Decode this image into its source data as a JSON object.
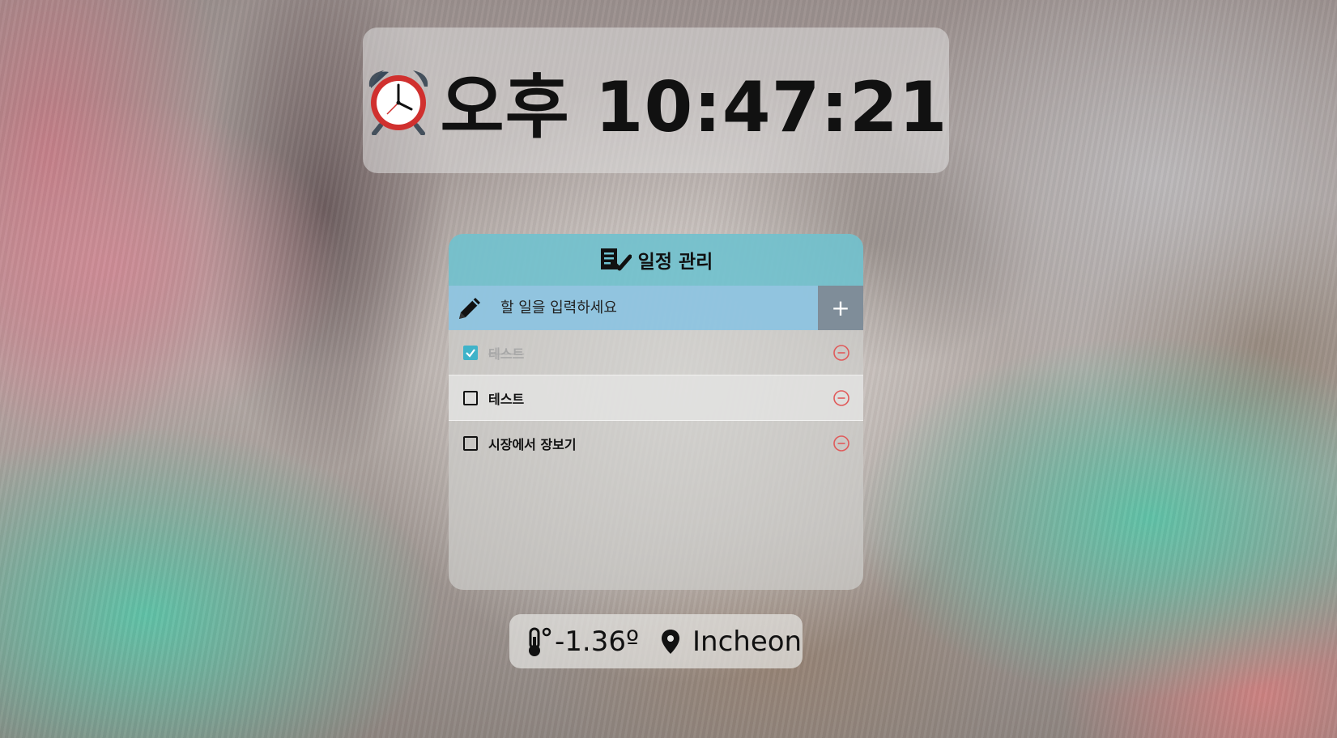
{
  "clock": {
    "time_text": "오후 10:47:21"
  },
  "todo": {
    "title": "일정 관리",
    "input_placeholder": "할 일을 입력하세요",
    "add_label": "+",
    "items": [
      {
        "label": "테스트",
        "checked": true
      },
      {
        "label": "테스트",
        "checked": false
      },
      {
        "label": "시장에서 장보기",
        "checked": false
      }
    ]
  },
  "weather": {
    "temperature": "-1.36º",
    "city": "Incheon"
  },
  "colors": {
    "accent_teal": "#3fb3c9",
    "remove_red": "#e05a5a",
    "input_bar_blue": "#8cc3e1"
  },
  "icons": {
    "clock": "alarm-clock-icon",
    "todo_header": "checklist-icon",
    "input": "pencil-icon",
    "remove": "minus-circle-icon",
    "temperature": "thermometer-icon",
    "location": "map-pin-icon"
  }
}
